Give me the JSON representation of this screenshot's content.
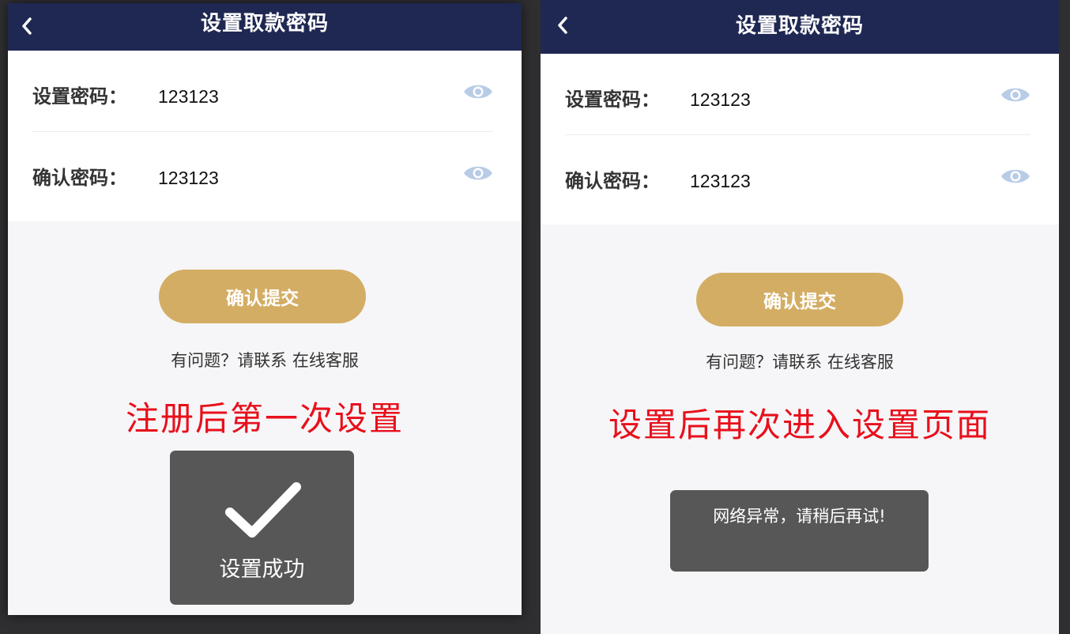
{
  "screens": [
    {
      "header": {
        "title": "设置取款密码"
      },
      "form": {
        "password_label": "设置密码：",
        "password_value": "123123",
        "confirm_label": "确认密码：",
        "confirm_value": "123123"
      },
      "submit_label": "确认提交",
      "help": {
        "prefix": "有问题？请联系",
        "link": "在线客服"
      },
      "caption": "注册后第一次设置",
      "toast": {
        "icon": "checkmark-icon",
        "message": "设置成功"
      }
    },
    {
      "header": {
        "title": "设置取款密码"
      },
      "form": {
        "password_label": "设置密码：",
        "password_value": "123123",
        "confirm_label": "确认密码：",
        "confirm_value": "123123"
      },
      "submit_label": "确认提交",
      "help": {
        "prefix": "有问题？请联系",
        "link": "在线客服"
      },
      "caption": "设置后再次进入设置页面",
      "toast": {
        "message": "网络异常，请稍后再试!"
      }
    }
  ],
  "colors": {
    "header_bg": "#1f2852",
    "accent_button": "#d4ad64",
    "caption_red": "#e8101c",
    "toast_bg": "#575757",
    "eye_icon": "#b8cce6"
  }
}
